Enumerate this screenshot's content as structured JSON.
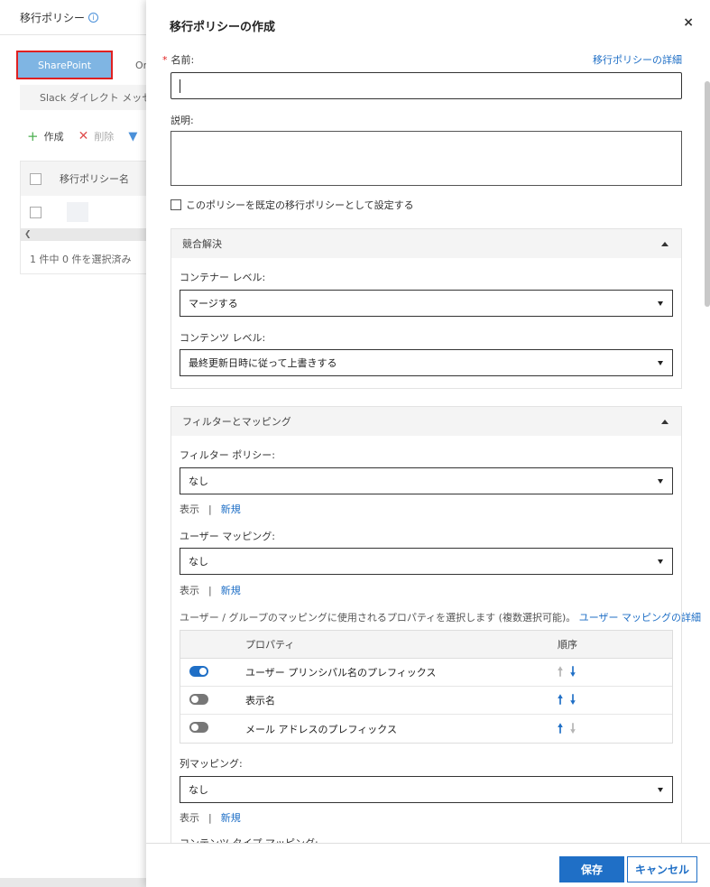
{
  "background": {
    "title": "移行ポリシー",
    "info_icon": "info-icon",
    "tabs": {
      "sharepoint": "SharePoint",
      "other": "On",
      "slack": "Slack ダイレクト メッセージ"
    },
    "toolbar": {
      "create": "作成",
      "delete": "削除"
    },
    "table": {
      "column": "移行ポリシー名"
    },
    "footer": "1 件中 0 件を選択済み"
  },
  "panel": {
    "title": "移行ポリシーの作成",
    "close": "×",
    "name_label": "名前:",
    "name_required": "*",
    "details_link": "移行ポリシーの詳細",
    "name_value": "",
    "description_label": "説明:",
    "description_value": "",
    "default_checkbox_label": "このポリシーを既定の移行ポリシーとして設定する",
    "conflict": {
      "header": "競合解決",
      "container_label": "コンテナー レベル:",
      "container_value": "マージする",
      "content_label": "コンテンツ レベル:",
      "content_value": "最終更新日時に従って上書きする"
    },
    "filters": {
      "header": "フィルターとマッピング",
      "filter_policy_label": "フィルター ポリシー:",
      "filter_policy_value": "なし",
      "user_mapping_label": "ユーザー マッピング:",
      "user_mapping_value": "なし",
      "show": "表示",
      "sep": "|",
      "new": "新規",
      "property_hint": "ユーザー / グループのマッピングに使用されるプロパティを選択します (複数選択可能)。",
      "user_mapping_details_link": "ユーザー マッピングの詳細",
      "table_headers": {
        "property": "プロパティ",
        "order": "順序"
      },
      "properties": [
        {
          "name": "ユーザー プリンシパル名のプレフィックス",
          "enabled": true,
          "up_active": false,
          "down_active": true
        },
        {
          "name": "表示名",
          "enabled": false,
          "up_active": true,
          "down_active": true
        },
        {
          "name": "メール アドレスのプレフィックス",
          "enabled": false,
          "up_active": true,
          "down_active": false
        }
      ],
      "column_mapping_label": "列マッピング:",
      "column_mapping_value": "なし",
      "content_type_mapping_label": "コンテンツ タイプ マッピング:"
    },
    "buttons": {
      "save": "保存",
      "cancel": "キャンセル"
    }
  }
}
